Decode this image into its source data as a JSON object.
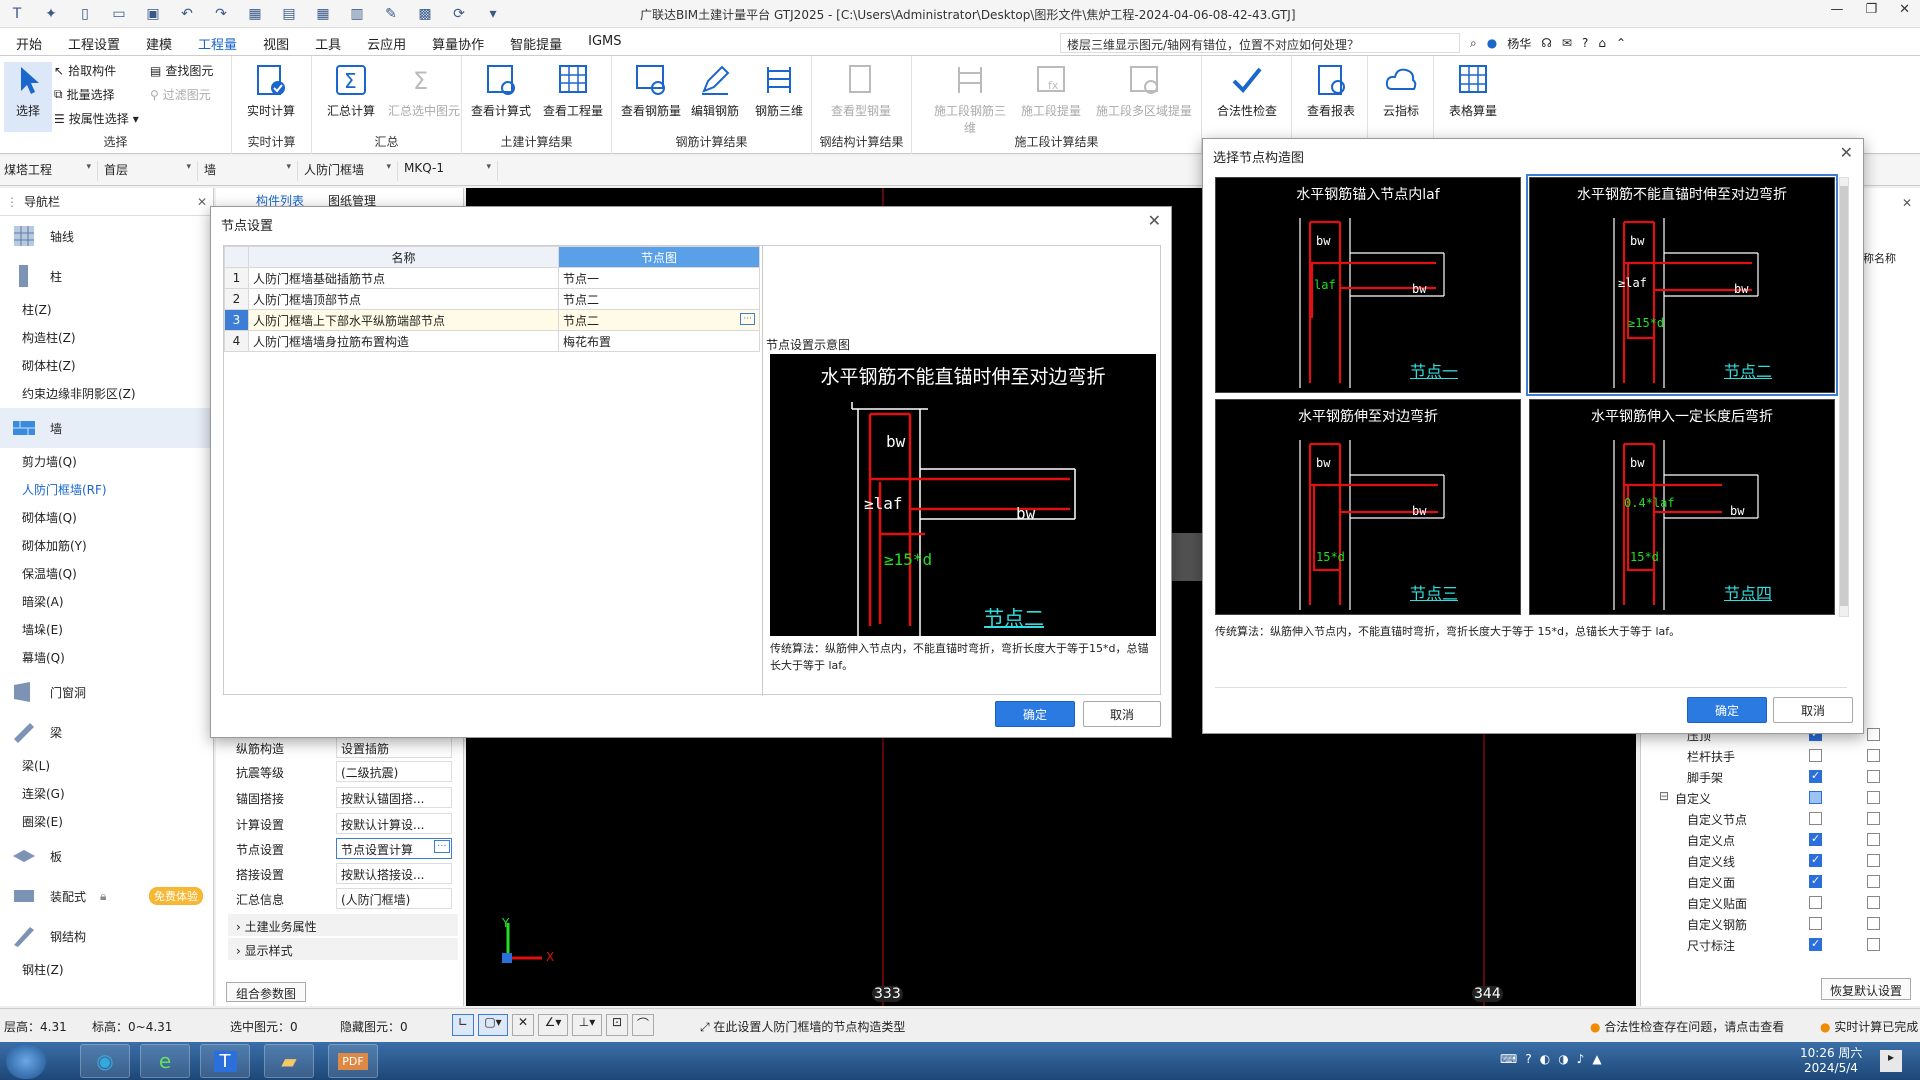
{
  "window": {
    "title": "广联达BIM土建计量平台 GTJ2025 - [C:\\Users\\Administrator\\Desktop\\图形文件\\焦炉工程-2024-04-06-08-42-43.GTJ]"
  },
  "menu": {
    "items": [
      "开始",
      "工程设置",
      "建模",
      "工程量",
      "视图",
      "工具",
      "云应用",
      "算量协作",
      "智能提量",
      "IGMS"
    ],
    "active": "工程量",
    "search_text": "楼层三维显示图元/轴网有错位，位置不对应如何处理？",
    "user": "杨华"
  },
  "ribbon": {
    "select_group": {
      "label": "选择",
      "select": "选择",
      "pick": "拾取构件",
      "batch": "批量选择",
      "byattr": "按属性选择",
      "find": "查找图元",
      "filter": "过滤图元"
    },
    "realtime_group": {
      "label": "实时计算",
      "btn": "实时计算"
    },
    "summary_group": {
      "label": "汇总",
      "sum": "汇总计算",
      "sum_sel": "汇总选中图元"
    },
    "civil_group": {
      "label": "土建计算结果",
      "formula": "查看计算式",
      "quantity": "查看工程量"
    },
    "rebar_group": {
      "label": "钢筋计算结果",
      "view": "查看钢筋量",
      "edit": "编辑钢筋",
      "rebar3d": "钢筋三维"
    },
    "steel_group": {
      "label": "钢结构计算结果",
      "view": "查看型钢量"
    },
    "construct_group": {
      "label": "施工段计算结果",
      "rebar3d": "施工段钢筋三维",
      "quantity": "施工段提量",
      "multi": "施工段多区域提量"
    },
    "check_btn": "合法性检查",
    "report_btn": "查看报表",
    "cloud_btn": "云指标",
    "table_btn": "表格算量"
  },
  "props_bar": {
    "project": "煤塔工程",
    "floor": "首层",
    "type": "墙",
    "subtype": "人防门框墙",
    "name": "MKQ-1"
  },
  "nav": {
    "title": "导航栏",
    "tabs": [
      "构件列表",
      "图纸管理"
    ],
    "categories": [
      {
        "label": "轴线",
        "icon": "grid-icon"
      },
      {
        "label": "柱",
        "icon": "column-icon",
        "subs": [
          "柱(Z)",
          "构造柱(Z)",
          "砌体柱(Z)",
          "约束边缘非阴影区(Z)"
        ]
      },
      {
        "label": "墙",
        "icon": "wall-icon",
        "subs": [
          "剪力墙(Q)",
          "人防门框墙(RF)",
          "砌体墙(Q)",
          "砌体加筋(Y)",
          "保温墙(Q)",
          "暗梁(A)",
          "墙垛(E)",
          "幕墙(Q)"
        ]
      },
      {
        "label": "门窗洞",
        "icon": "door-icon"
      },
      {
        "label": "梁",
        "icon": "beam-icon",
        "subs": [
          "梁(L)",
          "连梁(G)",
          "圈梁(E)"
        ]
      },
      {
        "label": "板",
        "icon": "slab-icon"
      },
      {
        "label": "装配式",
        "icon": "prefab-icon",
        "badge": "免费体验"
      },
      {
        "label": "钢结构",
        "icon": "steel-icon",
        "subs": [
          "钢柱(Z)"
        ]
      }
    ],
    "selected_sub": "人防门框墙(RF)"
  },
  "attr_panel": {
    "rows": [
      {
        "k": "纵筋构造",
        "v": "设置插筋"
      },
      {
        "k": "抗震等级",
        "v": "(二级抗震)"
      },
      {
        "k": "锚固搭接",
        "v": "按默认锚固搭..."
      },
      {
        "k": "计算设置",
        "v": "按默认计算设..."
      },
      {
        "k": "节点设置",
        "v": "节点设置计算"
      },
      {
        "k": "搭接设置",
        "v": "按默认搭接设..."
      },
      {
        "k": "汇总信息",
        "v": "(人防门框墙)"
      }
    ],
    "groups": [
      "土建业务属性",
      "显示样式"
    ],
    "combo_btn": "组合参数图"
  },
  "canvas": {
    "axis_labels": [
      "333",
      "344"
    ],
    "x_axis": "X",
    "y_axis": "Y"
  },
  "right_panel": {
    "header": "称名称",
    "rows": [
      {
        "label": "压顶",
        "a": true,
        "b": false
      },
      {
        "label": "栏杆扶手",
        "a": false,
        "b": false
      },
      {
        "label": "脚手架",
        "a": true,
        "b": false
      },
      {
        "label": "自定义",
        "a": "partial",
        "b": false,
        "group": true
      },
      {
        "label": "自定义节点",
        "a": false,
        "b": false
      },
      {
        "label": "自定义点",
        "a": true,
        "b": false
      },
      {
        "label": "自定义线",
        "a": true,
        "b": false
      },
      {
        "label": "自定义面",
        "a": true,
        "b": false
      },
      {
        "label": "自定义贴面",
        "a": false,
        "b": false
      },
      {
        "label": "自定义钢筋",
        "a": false,
        "b": false
      },
      {
        "label": "尺寸标注",
        "a": true,
        "b": false
      }
    ],
    "restore_btn": "恢复默认设置"
  },
  "node_dialog": {
    "title": "节点设置",
    "col_name": "名称",
    "col_node": "节点图",
    "rows": [
      {
        "idx": "1",
        "name": "人防门框墙基础插筋节点",
        "node": "节点一"
      },
      {
        "idx": "2",
        "name": "人防门框墙顶部节点",
        "node": "节点二"
      },
      {
        "idx": "3",
        "name": "人防门框墙上下部水平纵筋端部节点",
        "node": "节点二"
      },
      {
        "idx": "4",
        "name": "人防门框墙墙身拉筋布置构造",
        "node": "梅花布置"
      }
    ],
    "preview_label": "节点设置示意图",
    "preview_title": "水平钢筋不能直锚时伸至对边弯折",
    "preview_node": "节点二",
    "description": "传统算法：纵筋伸入节点内，不能直锚时弯折，弯折长度大于等于15*d，总锚长大于等于 laf。",
    "ok": "确定",
    "cancel": "取消"
  },
  "select_dialog": {
    "title": "选择节点构造图",
    "nodes": [
      {
        "title": "水平钢筋锚入节点内laf",
        "label": "节点一"
      },
      {
        "title": "水平钢筋不能直锚时伸至对边弯折",
        "label": "节点二"
      },
      {
        "title": "水平钢筋伸至对边弯折",
        "label": "节点三"
      },
      {
        "title": "水平钢筋伸入一定长度后弯折",
        "label": "节点四"
      }
    ],
    "selected": "节点二",
    "description": "传统算法：纵筋伸入节点内，不能直锚时弯折，弯折长度大于等于 15*d，总锚长大于等于 laf。",
    "ok": "确定",
    "cancel": "取消"
  },
  "drawing_labels": {
    "bw": "bw",
    "laf": "laf",
    "laf_ge": "≥laf",
    "d15": "≥15*d",
    "d15b": "15*d",
    "laf04": "0.4*laf"
  },
  "status": {
    "floor_height": "层高：4.31",
    "elevation": "标高：0~4.31",
    "selected": "选中图元：0",
    "hidden": "隐藏图元：0",
    "hint": "在此设置人防门框墙的节点构造类型",
    "check_msg": "合法性检查存在问题，请点击查看",
    "calc_msg": "实时计算已完成"
  },
  "taskbar": {
    "time": "10:26 周六",
    "date": "2024/5/4"
  },
  "colors": {
    "accent": "#1a66cc",
    "primary_button": "#2a7ae2",
    "rebar_red": "#e01010",
    "dim_green": "#22dd22",
    "node_cyan": "#33dddd"
  }
}
